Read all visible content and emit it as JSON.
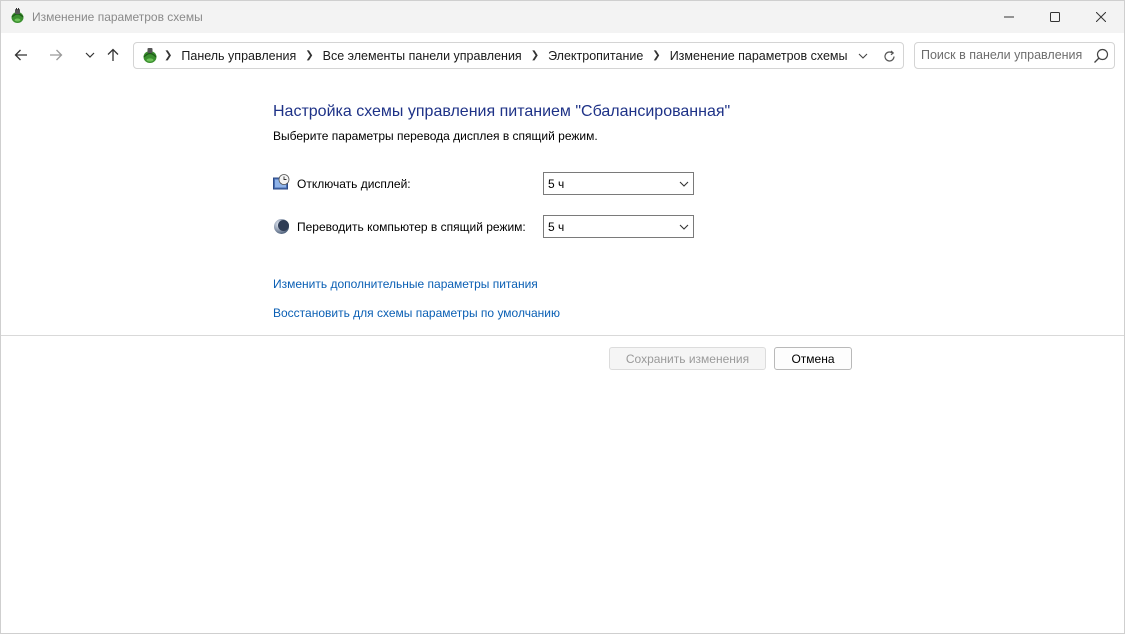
{
  "window": {
    "title": "Изменение параметров схемы"
  },
  "navigation": {
    "breadcrumbs": [
      "Панель управления",
      "Все элементы панели управления",
      "Электропитание",
      "Изменение параметров схемы"
    ],
    "search_placeholder": "Поиск в панели управления"
  },
  "content": {
    "heading": "Настройка схемы управления питанием \"Сбалансированная\"",
    "subheading": "Выберите параметры перевода дисплея в спящий режим.",
    "display_off": {
      "label": "Отключать дисплей:",
      "value": "5 ч"
    },
    "sleep": {
      "label": "Переводить компьютер в спящий режим:",
      "value": "5 ч"
    },
    "links": {
      "advanced": "Изменить дополнительные параметры питания",
      "restore": "Восстановить для схемы параметры по умолчанию"
    },
    "buttons": {
      "save": "Сохранить изменения",
      "cancel": "Отмена"
    }
  },
  "colors": {
    "heading": "#1e3287",
    "link": "#0a5fb4",
    "titlebar_bg": "#f3f3f3"
  },
  "icons": {
    "app": "power-options-icon",
    "display": "monitor-clock-icon",
    "sleep": "moon-icon"
  }
}
